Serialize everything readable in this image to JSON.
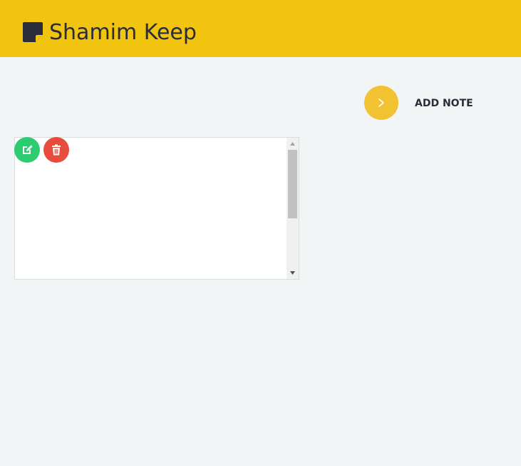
{
  "header": {
    "title": "Shamim Keep",
    "background_color": "#f1c40f",
    "logo_icon": "sticky-note-icon"
  },
  "actions": {
    "add_note_label": "ADD NOTE",
    "add_note_icon": "chevron-right-icon",
    "add_note_color": "#f1c232"
  },
  "notes": [
    {
      "content": "",
      "edit_icon": "edit-icon",
      "edit_color": "#2ecc71",
      "delete_icon": "trash-icon",
      "delete_color": "#e74c3c"
    }
  ],
  "colors": {
    "page_background": "#f2f5f6",
    "text_dark": "#2b2c3a"
  }
}
